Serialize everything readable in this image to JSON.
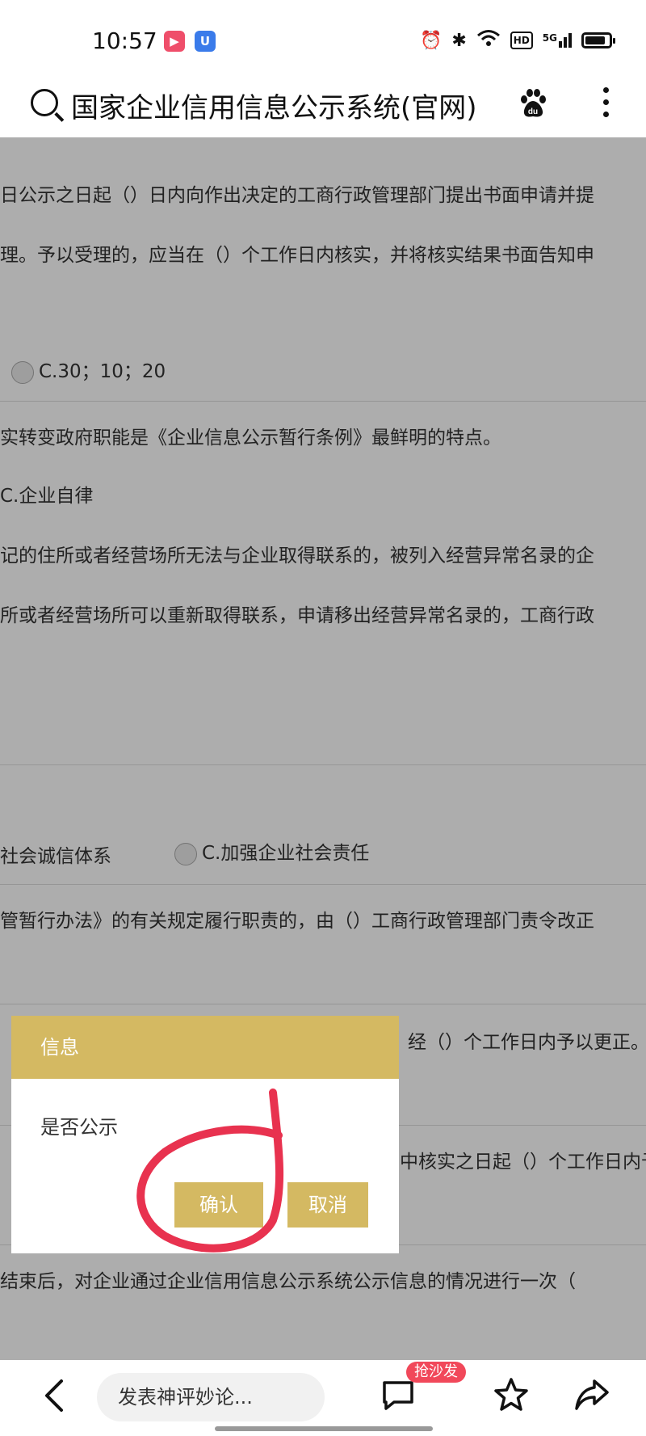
{
  "status_bar": {
    "time": "10:57",
    "hd": "HD",
    "net": "5G"
  },
  "search_bar": {
    "query": "国家企业信用信息公示系统(官网)"
  },
  "content_lines": [
    "日公示之日起（）日内向作出决定的工商行政管理部门提出书面申请并提",
    "理。予以受理的，应当在（）个工作日内核实，并将核实结果书面告知申",
    "C.30；10；20",
    "实转变政府职能是《企业信息公示暂行条例》最鲜明的特点。",
    "C.企业自律",
    "记的住所或者经营场所无法与企业取得联系的，被列入经营异常名录的企",
    "所或者经营场所可以重新取得联系，申请移出经营异常名录的，工商行政",
    "社会诚信体系",
    "C.加强企业社会责任",
    "管暂行办法》的有关规定履行职责的，由（）工商行政管理部门责令改正",
    "经（）个工作日内予以更正。",
    "中核实之日起（）个工作日内予",
    "结束后，对企业通过企业信用信息公示系统公示信息的情况进行一次（"
  ],
  "dialog": {
    "title": "信息",
    "message": "是否公示",
    "confirm_label": "确认",
    "cancel_label": "取消",
    "header_color": "#d4b962"
  },
  "bottom_bar": {
    "comment_placeholder": "发表神评妙论...",
    "badge": "抢沙发"
  }
}
